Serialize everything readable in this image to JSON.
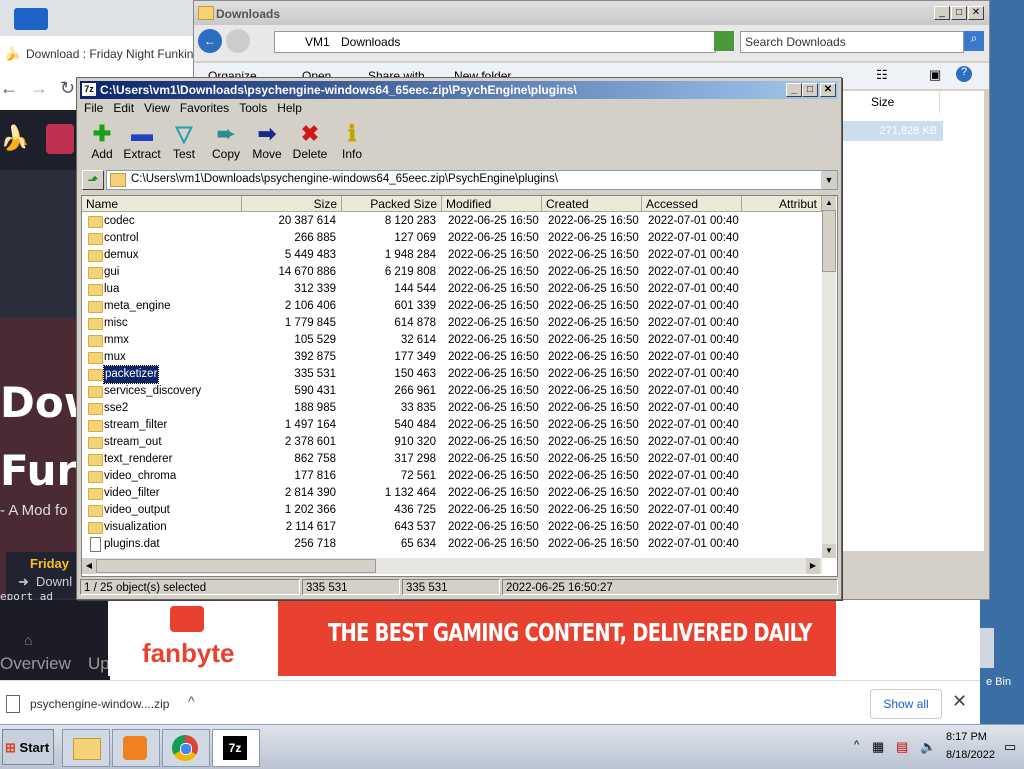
{
  "browser": {
    "tab_title": "Download : Friday Night Funkin' -",
    "hero_line1": "Dow",
    "hero_line2": "Fur",
    "hero_sub": "- A Mod fo",
    "side_title": "Friday",
    "side_download": "Downl",
    "report_ad": "eport ad",
    "footer_overview": "Overview",
    "footer_up": "Up",
    "ad_brand": "fanbyte",
    "ad_text": "THE BEST GAMING CONTENT, DELIVERED DAILY",
    "download_file": "psychengine-window....zip",
    "show_all": "Show all"
  },
  "explorer": {
    "title": "Downloads",
    "breadcrumb": [
      "VM1",
      "Downloads"
    ],
    "search_placeholder": "Search Downloads",
    "toolbar": [
      "Organize",
      "Open",
      "Share with",
      "New folder"
    ],
    "col_size": "Size",
    "size_value": "271,828 KB",
    "recycle_label": "e Bin"
  },
  "sevenzip": {
    "title": "C:\\Users\\vm1\\Downloads\\psychengine-windows64_65eec.zip\\PsychEngine\\plugins\\",
    "menu": [
      "File",
      "Edit",
      "View",
      "Favorites",
      "Tools",
      "Help"
    ],
    "tools": [
      {
        "label": "Add",
        "icon": "plus-icon",
        "color": "#1aa11a"
      },
      {
        "label": "Extract",
        "icon": "minus-icon",
        "color": "#2040c0"
      },
      {
        "label": "Test",
        "icon": "check-icon",
        "color": "#20a0b0"
      },
      {
        "label": "Copy",
        "icon": "copy-arrow-icon",
        "color": "#2c8c8c"
      },
      {
        "label": "Move",
        "icon": "move-arrow-icon",
        "color": "#1a2a8a"
      },
      {
        "label": "Delete",
        "icon": "delete-x-icon",
        "color": "#d01818"
      },
      {
        "label": "Info",
        "icon": "info-icon",
        "color": "#c8a000"
      }
    ],
    "path": "C:\\Users\\vm1\\Downloads\\psychengine-windows64_65eec.zip\\PsychEngine\\plugins\\",
    "columns": [
      "Name",
      "Size",
      "Packed Size",
      "Modified",
      "Created",
      "Accessed",
      "Attribut"
    ],
    "rows": [
      {
        "name": "codec",
        "size": "20 387 614",
        "packed": "8 120 283",
        "modified": "2022-06-25 16:50",
        "created": "2022-06-25 16:50",
        "accessed": "2022-07-01 00:40",
        "type": "folder"
      },
      {
        "name": "control",
        "size": "266 885",
        "packed": "127 069",
        "modified": "2022-06-25 16:50",
        "created": "2022-06-25 16:50",
        "accessed": "2022-07-01 00:40",
        "type": "folder"
      },
      {
        "name": "demux",
        "size": "5 449 483",
        "packed": "1 948 284",
        "modified": "2022-06-25 16:50",
        "created": "2022-06-25 16:50",
        "accessed": "2022-07-01 00:40",
        "type": "folder"
      },
      {
        "name": "gui",
        "size": "14 670 886",
        "packed": "6 219 808",
        "modified": "2022-06-25 16:50",
        "created": "2022-06-25 16:50",
        "accessed": "2022-07-01 00:40",
        "type": "folder"
      },
      {
        "name": "lua",
        "size": "312 339",
        "packed": "144 544",
        "modified": "2022-06-25 16:50",
        "created": "2022-06-25 16:50",
        "accessed": "2022-07-01 00:40",
        "type": "folder"
      },
      {
        "name": "meta_engine",
        "size": "2 106 406",
        "packed": "601 339",
        "modified": "2022-06-25 16:50",
        "created": "2022-06-25 16:50",
        "accessed": "2022-07-01 00:40",
        "type": "folder"
      },
      {
        "name": "misc",
        "size": "1 779 845",
        "packed": "614 878",
        "modified": "2022-06-25 16:50",
        "created": "2022-06-25 16:50",
        "accessed": "2022-07-01 00:40",
        "type": "folder"
      },
      {
        "name": "mmx",
        "size": "105 529",
        "packed": "32 614",
        "modified": "2022-06-25 16:50",
        "created": "2022-06-25 16:50",
        "accessed": "2022-07-01 00:40",
        "type": "folder"
      },
      {
        "name": "mux",
        "size": "392 875",
        "packed": "177 349",
        "modified": "2022-06-25 16:50",
        "created": "2022-06-25 16:50",
        "accessed": "2022-07-01 00:40",
        "type": "folder"
      },
      {
        "name": "packetizer",
        "size": "335 531",
        "packed": "150 463",
        "modified": "2022-06-25 16:50",
        "created": "2022-06-25 16:50",
        "accessed": "2022-07-01 00:40",
        "type": "folder",
        "selected": true
      },
      {
        "name": "services_discovery",
        "size": "590 431",
        "packed": "266 961",
        "modified": "2022-06-25 16:50",
        "created": "2022-06-25 16:50",
        "accessed": "2022-07-01 00:40",
        "type": "folder"
      },
      {
        "name": "sse2",
        "size": "188 985",
        "packed": "33 835",
        "modified": "2022-06-25 16:50",
        "created": "2022-06-25 16:50",
        "accessed": "2022-07-01 00:40",
        "type": "folder"
      },
      {
        "name": "stream_filter",
        "size": "1 497 164",
        "packed": "540 484",
        "modified": "2022-06-25 16:50",
        "created": "2022-06-25 16:50",
        "accessed": "2022-07-01 00:40",
        "type": "folder"
      },
      {
        "name": "stream_out",
        "size": "2 378 601",
        "packed": "910 320",
        "modified": "2022-06-25 16:50",
        "created": "2022-06-25 16:50",
        "accessed": "2022-07-01 00:40",
        "type": "folder"
      },
      {
        "name": "text_renderer",
        "size": "862 758",
        "packed": "317 298",
        "modified": "2022-06-25 16:50",
        "created": "2022-06-25 16:50",
        "accessed": "2022-07-01 00:40",
        "type": "folder"
      },
      {
        "name": "video_chroma",
        "size": "177 816",
        "packed": "72 561",
        "modified": "2022-06-25 16:50",
        "created": "2022-06-25 16:50",
        "accessed": "2022-07-01 00:40",
        "type": "folder"
      },
      {
        "name": "video_filter",
        "size": "2 814 390",
        "packed": "1 132 464",
        "modified": "2022-06-25 16:50",
        "created": "2022-06-25 16:50",
        "accessed": "2022-07-01 00:40",
        "type": "folder"
      },
      {
        "name": "video_output",
        "size": "1 202 366",
        "packed": "436 725",
        "modified": "2022-06-25 16:50",
        "created": "2022-06-25 16:50",
        "accessed": "2022-07-01 00:40",
        "type": "folder"
      },
      {
        "name": "visualization",
        "size": "2 114 617",
        "packed": "643 537",
        "modified": "2022-06-25 16:50",
        "created": "2022-06-25 16:50",
        "accessed": "2022-07-01 00:40",
        "type": "folder"
      },
      {
        "name": "plugins.dat",
        "size": "256 718",
        "packed": "65 634",
        "modified": "2022-06-25 16:50",
        "created": "2022-06-25 16:50",
        "accessed": "2022-07-01 00:40",
        "type": "file"
      }
    ],
    "status": [
      "1 / 25 object(s) selected",
      "335 531",
      "335 531",
      "2022-06-25 16:50:27"
    ]
  },
  "taskbar": {
    "start_label": "Start",
    "time": "8:17 PM",
    "date": "8/18/2022"
  }
}
